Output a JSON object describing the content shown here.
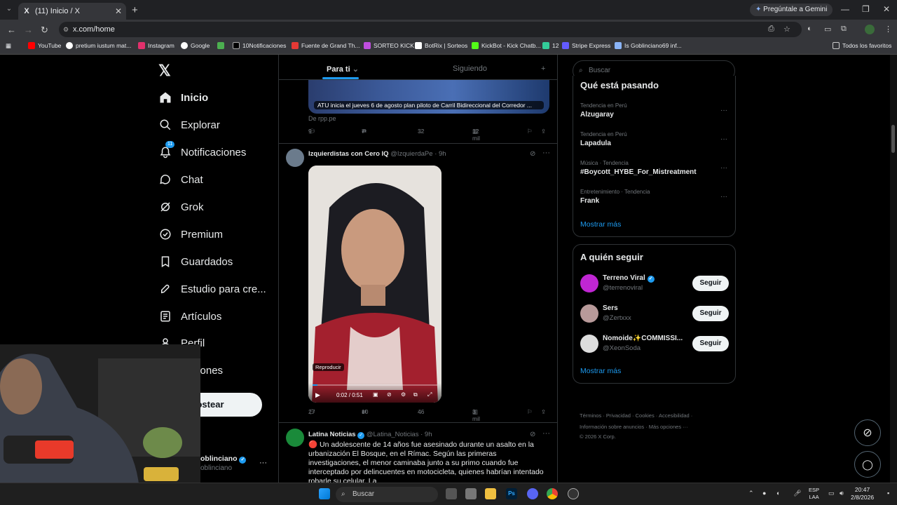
{
  "browser": {
    "tab_title": "(11) Inicio / X",
    "tab_favicon": "X",
    "gemini_label": "Pregúntale a Gemini",
    "url": "x.com/home",
    "bookmarks": [
      "YouTube",
      "pretium iustum mat...",
      "Instagram",
      "Google",
      "10Notificaciones",
      "Fuente de Grand Th...",
      "SORTEO KICK",
      "BotRix | Sorteos",
      "KickBot - Kick Chatb...",
      "12",
      "Stripe Express",
      "Is Goblinciano69 inf..."
    ],
    "other_bookmarks": "Todos los favoritos"
  },
  "nav": {
    "items": [
      {
        "label": "Inicio",
        "icon": "home-icon"
      },
      {
        "label": "Explorar",
        "icon": "search-icon"
      },
      {
        "label": "Notificaciones",
        "icon": "bell-icon",
        "badge": "11"
      },
      {
        "label": "Chat",
        "icon": "chat-icon"
      },
      {
        "label": "Grok",
        "icon": "grok-icon"
      },
      {
        "label": "Premium",
        "icon": "premium-icon"
      },
      {
        "label": "Guardados",
        "icon": "bookmark-icon"
      },
      {
        "label": "Estudio para cre...",
        "icon": "rocket-icon"
      },
      {
        "label": "Artículos",
        "icon": "articles-icon"
      },
      {
        "label": "Perfil",
        "icon": "profile-icon"
      },
      {
        "label": "opciones",
        "icon": "more-icon"
      }
    ],
    "post_button": "ostear",
    "account_name": "oblinciano",
    "account_handle": "oblinciano"
  },
  "feed": {
    "tabs": [
      "Para ti",
      "Siguiendo"
    ],
    "tweet1": {
      "card_caption": "ATU inicia el jueves 6 de agosto plan piloto de Carril Bidireccional del Corredor ...",
      "source": "De rpp.pe",
      "replies": "9",
      "retweets": "7",
      "likes": "32",
      "views": "12 mil"
    },
    "tweet2": {
      "name": "Izquierdistas con Cero IQ",
      "handle": "@IzquierdaPe",
      "time": "9h",
      "video_tooltip": "Reproducir",
      "video_time": "0:02 / 0:51",
      "replies": "27",
      "retweets": "10",
      "likes": "46",
      "views": "3 mil"
    },
    "tweet3": {
      "name": "Latina Noticias",
      "handle": "@Latina_Noticias",
      "time": "9h",
      "text": "🔴 Un adolescente de 14 años fue asesinado durante un asalto en la urbanización El Bosque, en el Rímac. Según las primeras investigaciones, el menor caminaba junto a su primo cuando fue interceptado por delincuentes en motocicleta, quienes habrían intentado robarle su celular. La"
    }
  },
  "sidebar": {
    "search_placeholder": "Buscar",
    "trending_title": "Qué está pasando",
    "trends": [
      {
        "context": "Tendencia en Perú",
        "name": "Alzugaray"
      },
      {
        "context": "Tendencia en Perú",
        "name": "Lapadula"
      },
      {
        "context": "Música · Tendencia",
        "name": "#Boycott_HYBE_For_Mistreatment"
      },
      {
        "context": "Entretenimiento · Tendencia",
        "name": "Frank"
      }
    ],
    "show_more": "Mostrar más",
    "follow_title": "A quién seguir",
    "follow": [
      {
        "name": "Terreno Viral",
        "handle": "@terrenoviral",
        "button": "Seguir",
        "color": "#c026d3"
      },
      {
        "name": "Sers",
        "handle": "@Zertxxx",
        "button": "Seguir",
        "color": "#b89a9a"
      },
      {
        "name": "Ñomoide✨COMMISSI...",
        "handle": "@XeonSoda",
        "button": "Seguir",
        "color": "#ddd"
      }
    ],
    "follow_more": "Mostrar más",
    "footer_line1": "Términos · Privacidad · Cookies · Accesibilidad ·",
    "footer_line2": "Información sobre anuncios · Más opciones ···",
    "footer_line3": "© 2026 X Corp."
  },
  "taskbar": {
    "search": "Buscar",
    "lang": "ESP",
    "lang2": "LAA",
    "time": "20:47",
    "date": "2/8/2026"
  }
}
